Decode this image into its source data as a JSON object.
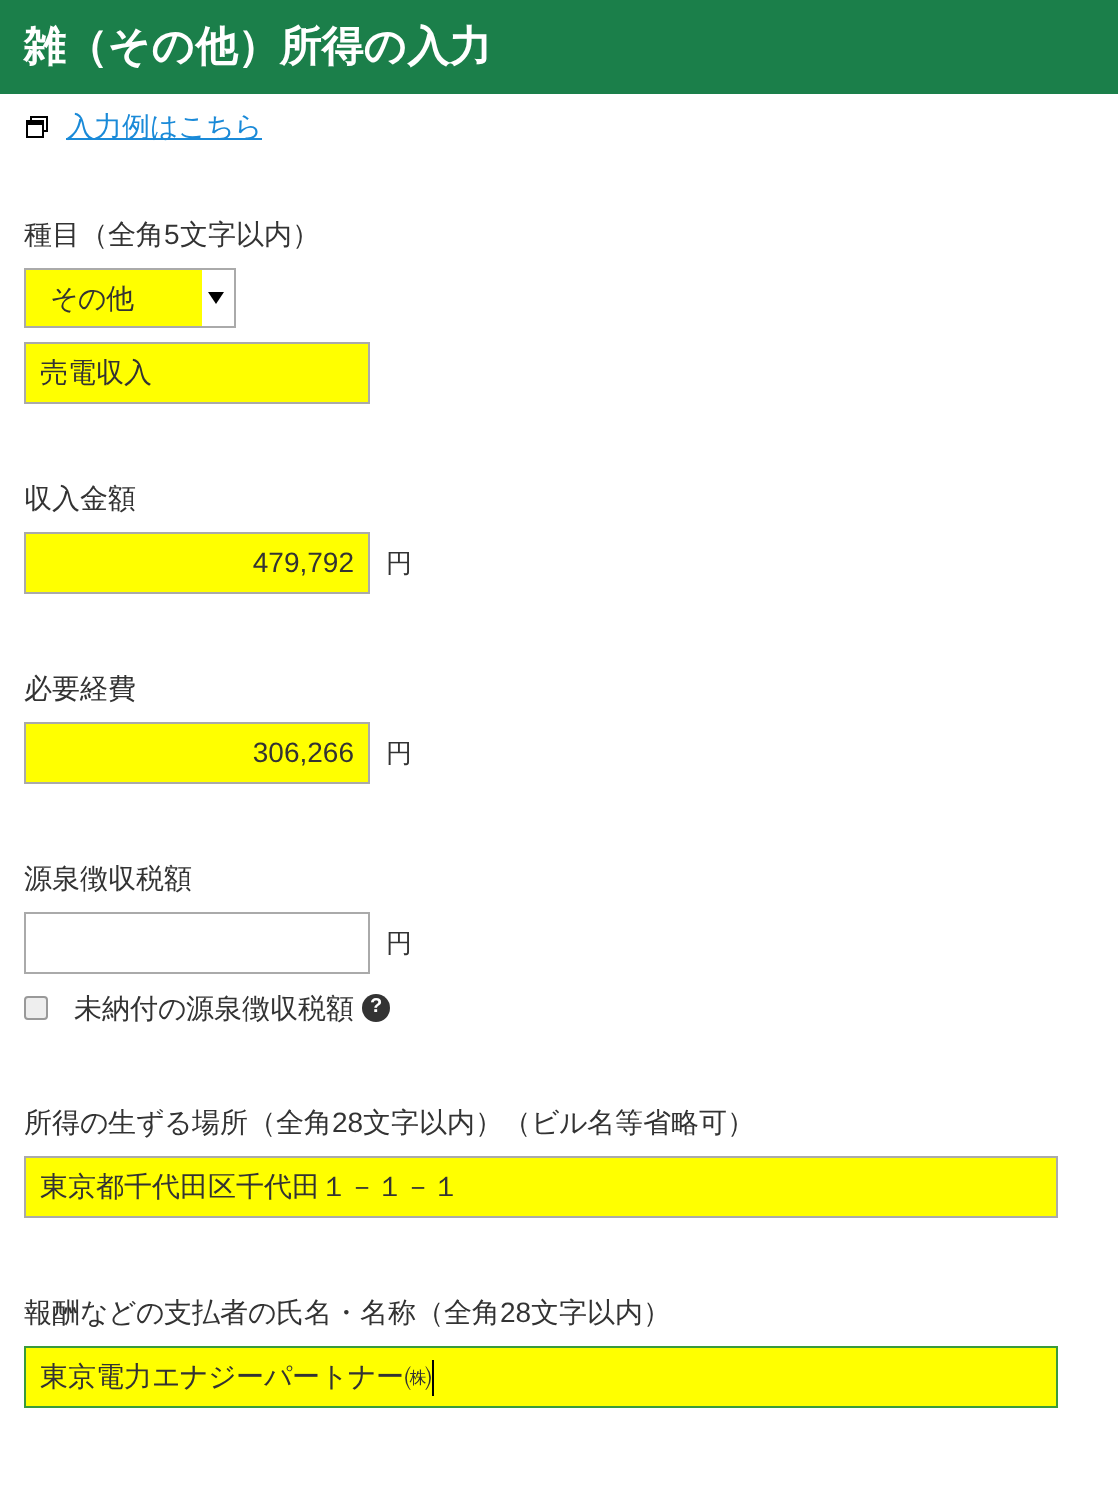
{
  "header": {
    "title": "雑（その他）所得の入力"
  },
  "example_link": {
    "label": "入力例はこちら"
  },
  "sections": [
    {
      "label": "種目（全角5文字以内）",
      "controls": [
        {
          "kind": "select",
          "value": "その他",
          "highlighted": true
        },
        {
          "kind": "text",
          "value": "売電収入",
          "highlighted": true,
          "focused": false
        }
      ]
    },
    {
      "label": "収入金額",
      "controls": [
        {
          "kind": "amount",
          "value": "479,792",
          "unit": "円",
          "highlighted": true
        }
      ]
    },
    {
      "label": "必要経費",
      "controls": [
        {
          "kind": "amount",
          "value": "306,266",
          "unit": "円",
          "highlighted": true
        }
      ]
    },
    {
      "label": "源泉徴収税額",
      "controls": [
        {
          "kind": "amount",
          "unit": "円",
          "highlighted": false
        },
        {
          "kind": "checkbox",
          "label": "未納付の源泉徴収税額",
          "checked": false,
          "help": "?"
        }
      ]
    },
    {
      "label": "所得の生ずる場所（全角28文字以内）（ビル名等省略可）",
      "controls": [
        {
          "kind": "wide_text",
          "value": "東京都千代田区千代田１－１－１",
          "highlighted": true,
          "focused": false
        }
      ]
    },
    {
      "label": "報酬などの支払者の氏名・名称（全角28文字以内）",
      "controls": [
        {
          "kind": "wide_text",
          "value": "東京電力エナジーパートナー㈱",
          "highlighted": true,
          "focused": true
        }
      ]
    }
  ]
}
